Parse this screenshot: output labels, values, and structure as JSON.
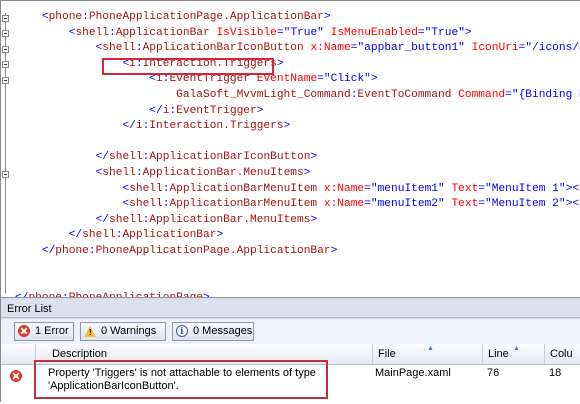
{
  "editor": {
    "lines": [
      {
        "indent": "    ",
        "parts": [
          [
            "pl",
            "<"
          ],
          [
            "ns",
            "phone"
          ],
          [
            "pl",
            ":"
          ],
          [
            "el",
            "PhoneApplicationPage.ApplicationBar"
          ],
          [
            "pl",
            ">"
          ]
        ]
      },
      {
        "indent": "        ",
        "parts": [
          [
            "pl",
            "<"
          ],
          [
            "ns",
            "shell"
          ],
          [
            "pl",
            ":"
          ],
          [
            "el",
            "ApplicationBar"
          ],
          [
            "tx",
            " "
          ],
          [
            "at",
            "IsVisible"
          ],
          [
            "eq",
            "="
          ],
          [
            "va",
            "\"True\""
          ],
          [
            "tx",
            " "
          ],
          [
            "at",
            "IsMenuEnabled"
          ],
          [
            "eq",
            "="
          ],
          [
            "va",
            "\"True\""
          ],
          [
            "pl",
            ">"
          ]
        ]
      },
      {
        "indent": "            ",
        "parts": [
          [
            "pl",
            "<"
          ],
          [
            "ns",
            "shell"
          ],
          [
            "pl",
            ":"
          ],
          [
            "el",
            "ApplicationBarIconButton"
          ],
          [
            "tx",
            " "
          ],
          [
            "at",
            "x:Name"
          ],
          [
            "eq",
            "="
          ],
          [
            "va",
            "\"appbar_button1\""
          ],
          [
            "tx",
            " "
          ],
          [
            "at",
            "IconUri"
          ],
          [
            "eq",
            "="
          ],
          [
            "va",
            "\"/icons/appb"
          ]
        ]
      },
      {
        "indent": "                ",
        "parts": [
          [
            "pl",
            "<"
          ],
          [
            "ns",
            "i"
          ],
          [
            "pl",
            ":"
          ],
          [
            "el",
            "Interaction.Triggers"
          ],
          [
            "pl",
            ">"
          ]
        ]
      },
      {
        "indent": "                    ",
        "parts": [
          [
            "pl",
            "<"
          ],
          [
            "ns",
            "i"
          ],
          [
            "pl",
            ":"
          ],
          [
            "el",
            "EventTrigger"
          ],
          [
            "tx",
            " "
          ],
          [
            "at",
            "EventName"
          ],
          [
            "eq",
            "="
          ],
          [
            "va",
            "\"Click\""
          ],
          [
            "pl",
            ">"
          ]
        ]
      },
      {
        "indent": "                        ",
        "parts": [
          [
            "ns",
            "GalaSoft_MvvmLight_Command"
          ],
          [
            "pl",
            ":"
          ],
          [
            "el",
            "EventToCommand"
          ],
          [
            "tx",
            " "
          ],
          [
            "at",
            "Command"
          ],
          [
            "eq",
            "="
          ],
          [
            "va",
            "\"{Binding Dis"
          ]
        ]
      },
      {
        "indent": "                    ",
        "parts": [
          [
            "pl",
            "</"
          ],
          [
            "ns",
            "i"
          ],
          [
            "pl",
            ":"
          ],
          [
            "el",
            "EventTrigger"
          ],
          [
            "pl",
            ">"
          ]
        ]
      },
      {
        "indent": "                ",
        "parts": [
          [
            "pl",
            "</"
          ],
          [
            "ns",
            "i"
          ],
          [
            "pl",
            ":"
          ],
          [
            "el",
            "Interaction.Triggers"
          ],
          [
            "pl",
            ">"
          ]
        ]
      },
      {
        "indent": "",
        "parts": []
      },
      {
        "indent": "            ",
        "parts": [
          [
            "pl",
            "</"
          ],
          [
            "ns",
            "shell"
          ],
          [
            "pl",
            ":"
          ],
          [
            "el",
            "ApplicationBarIconButton"
          ],
          [
            "pl",
            ">"
          ]
        ]
      },
      {
        "indent": "            ",
        "parts": [
          [
            "pl",
            "<"
          ],
          [
            "ns",
            "shell"
          ],
          [
            "pl",
            ":"
          ],
          [
            "el",
            "ApplicationBar.MenuItems"
          ],
          [
            "pl",
            ">"
          ]
        ]
      },
      {
        "indent": "                ",
        "parts": [
          [
            "pl",
            "<"
          ],
          [
            "ns",
            "shell"
          ],
          [
            "pl",
            ":"
          ],
          [
            "el",
            "ApplicationBarMenuItem"
          ],
          [
            "tx",
            " "
          ],
          [
            "at",
            "x:Name"
          ],
          [
            "eq",
            "="
          ],
          [
            "va",
            "\"menuItem1\""
          ],
          [
            "tx",
            " "
          ],
          [
            "at",
            "Text"
          ],
          [
            "eq",
            "="
          ],
          [
            "va",
            "\"MenuItem 1\""
          ],
          [
            "pl",
            "></sh"
          ]
        ]
      },
      {
        "indent": "                ",
        "parts": [
          [
            "pl",
            "<"
          ],
          [
            "ns",
            "shell"
          ],
          [
            "pl",
            ":"
          ],
          [
            "el",
            "ApplicationBarMenuItem"
          ],
          [
            "tx",
            " "
          ],
          [
            "at",
            "x:Name"
          ],
          [
            "eq",
            "="
          ],
          [
            "va",
            "\"menuItem2\""
          ],
          [
            "tx",
            " "
          ],
          [
            "at",
            "Text"
          ],
          [
            "eq",
            "="
          ],
          [
            "va",
            "\"MenuItem 2\""
          ],
          [
            "pl",
            "></sh"
          ]
        ]
      },
      {
        "indent": "            ",
        "parts": [
          [
            "pl",
            "</"
          ],
          [
            "ns",
            "shell"
          ],
          [
            "pl",
            ":"
          ],
          [
            "el",
            "ApplicationBar.MenuItems"
          ],
          [
            "pl",
            ">"
          ]
        ]
      },
      {
        "indent": "        ",
        "parts": [
          [
            "pl",
            "</"
          ],
          [
            "ns",
            "shell"
          ],
          [
            "pl",
            ":"
          ],
          [
            "el",
            "ApplicationBar"
          ],
          [
            "pl",
            ">"
          ]
        ]
      },
      {
        "indent": "    ",
        "parts": [
          [
            "pl",
            "</"
          ],
          [
            "ns",
            "phone"
          ],
          [
            "pl",
            ":"
          ],
          [
            "el",
            "PhoneApplicationPage.ApplicationBar"
          ],
          [
            "pl",
            ">"
          ]
        ]
      },
      {
        "indent": "",
        "parts": []
      },
      {
        "indent": "",
        "parts": []
      },
      {
        "indent": "",
        "parts": [
          [
            "pl",
            "</"
          ],
          [
            "ns",
            "phone"
          ],
          [
            "pl",
            ":"
          ],
          [
            "el",
            "PhoneApplicationPage"
          ],
          [
            "pl",
            ">"
          ]
        ]
      }
    ]
  },
  "error_list": {
    "title": "Error List",
    "errors_label": "1 Error",
    "warnings_label": "0 Warnings",
    "messages_label": "0 Messages",
    "columns": {
      "description": "Description",
      "file": "File",
      "line": "Line",
      "column": "Colu"
    },
    "rows": [
      {
        "description_line1": "Property 'Triggers' is not attachable to elements of type",
        "description_line2": "'ApplicationBarIconButton'.",
        "file": "MainPage.xaml",
        "line": "76",
        "column": "18"
      }
    ]
  }
}
